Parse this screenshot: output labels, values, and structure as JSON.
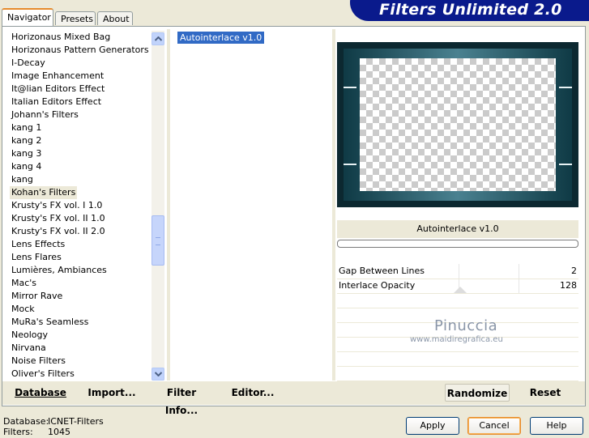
{
  "tabs": [
    {
      "label": "Navigator",
      "active": true
    },
    {
      "label": "Presets",
      "active": false
    },
    {
      "label": "About",
      "active": false
    }
  ],
  "app_title": "Filters Unlimited 2.0",
  "categories": [
    "Horizonaus Mixed Bag",
    "Horizonaus Pattern Generators",
    "I-Decay",
    "Image Enhancement",
    "It@lian Editors Effect",
    "Italian Editors Effect",
    "Johann's Filters",
    "kang 1",
    "kang 2",
    "kang 3",
    "kang 4",
    "kang",
    "Kohan's Filters",
    "Krusty's FX vol. I 1.0",
    "Krusty's FX vol. II 1.0",
    "Krusty's FX vol. II 2.0",
    "Lens Effects",
    "Lens Flares",
    "Lumières, Ambiances",
    "Mac's",
    "Mirror Rave",
    "Mock",
    "MuRa's Seamless",
    "Neology",
    "Nirvana",
    "Noise Filters",
    "Oliver's Filters"
  ],
  "selected_category": "Kohan's Filters",
  "filters": [
    "Autointerlace v1.0"
  ],
  "selected_filter_title": "Autointerlace v1.0",
  "parameters": [
    {
      "label": "Gap Between Lines",
      "value": "2"
    },
    {
      "label": "Interlace Opacity",
      "value": "128"
    }
  ],
  "watermark": {
    "name": "Pinuccia",
    "url": "www.maidiregrafica.eu"
  },
  "bottom_links": {
    "database": "Database",
    "import": "Import...",
    "filter_info": "Filter Info...",
    "editor": "Editor...",
    "randomize": "Randomize",
    "reset": "Reset"
  },
  "status": {
    "database_label": "Database:",
    "database_value": "ICNET-Filters",
    "filters_label": "Filters:",
    "filters_value": "1045"
  },
  "dialog_buttons": {
    "apply": "Apply",
    "cancel": "Cancel",
    "help": "Help"
  },
  "colors": {
    "banner": "#0a1a8c",
    "selection": "#316ac5",
    "accent": "#e68b2c"
  }
}
